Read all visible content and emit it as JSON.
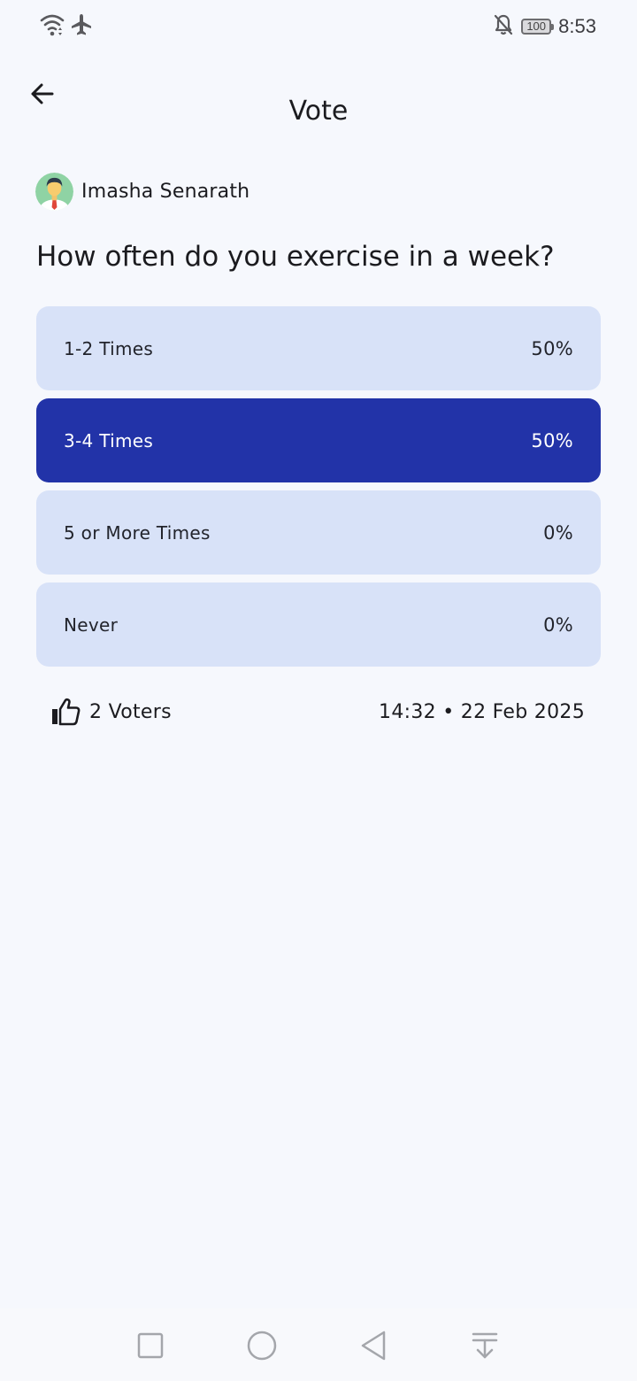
{
  "status_bar": {
    "time": "8:53",
    "battery": "100",
    "icons": [
      "wifi-icon",
      "airplane-mode-icon",
      "notifications-off-icon",
      "battery-icon"
    ]
  },
  "app_bar": {
    "title": "Vote",
    "back_icon": "arrow-left-icon"
  },
  "poll": {
    "author": "Imasha Senarath",
    "question": "How often do you exercise in a week?",
    "options": [
      {
        "label": "1-2 Times",
        "percent": "50%",
        "selected": false
      },
      {
        "label": "3-4 Times",
        "percent": "50%",
        "selected": true
      },
      {
        "label": "5 or More Times",
        "percent": "0%",
        "selected": false
      },
      {
        "label": "Never",
        "percent": "0%",
        "selected": false
      }
    ],
    "voters": "2 Voters",
    "timestamp": "14:32 • 22 Feb 2025"
  },
  "colors": {
    "background": "#f6f8fd",
    "option_bg": "#d8e2f8",
    "option_selected_bg": "#2233a8"
  },
  "nav_bar": {
    "icons": [
      "recent-apps-icon",
      "home-icon",
      "back-icon",
      "notification-pull-icon"
    ]
  }
}
